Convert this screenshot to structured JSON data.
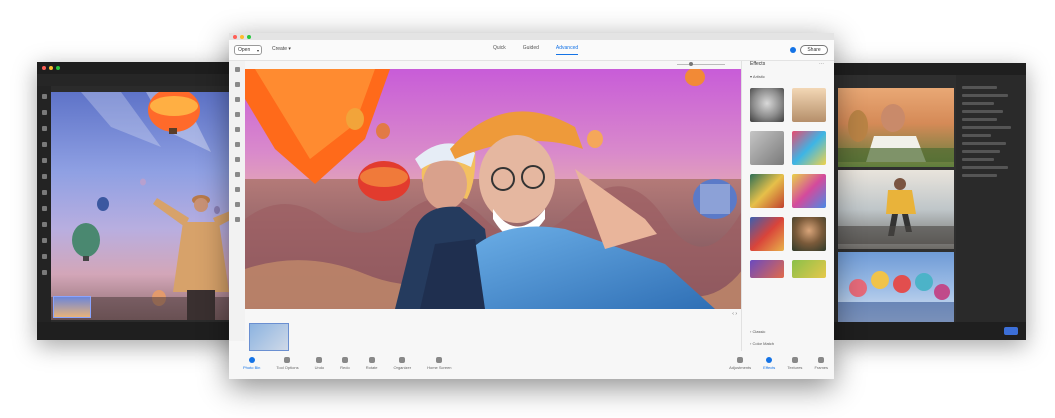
{
  "left_window": {
    "menu": [
      "",
      "",
      ""
    ],
    "filmstrip_label": "",
    "bottom_items": [
      "",
      "",
      "",
      "",
      "",
      ""
    ]
  },
  "main_window": {
    "topbar": {
      "open_label": "Open",
      "create_label": "Create",
      "modes": [
        "Quick",
        "Guided",
        "Advanced"
      ],
      "active_mode": "Advanced",
      "share_label": "Share"
    },
    "subbar": {
      "zoom_label": ""
    },
    "canvas_footer": {
      "label": ""
    },
    "bottom_left": [
      {
        "label": "Photo Bin"
      },
      {
        "label": "Tool Options"
      },
      {
        "label": "Undo"
      },
      {
        "label": "Redo"
      },
      {
        "label": "Rotate"
      },
      {
        "label": "Organizer"
      },
      {
        "label": "Home Screen"
      }
    ],
    "bottom_right": [
      {
        "label": "Adjustments"
      },
      {
        "label": "Effects"
      },
      {
        "label": "Textures"
      },
      {
        "label": "Frames"
      }
    ],
    "effects_panel": {
      "title": "Effects",
      "category": "Artistic",
      "sections": [
        "Classic",
        "Color Match"
      ]
    }
  },
  "colors": {
    "accent": "#1473e6",
    "dark_bg": "#2b2b2b",
    "light_bg": "#f7f7f7"
  }
}
